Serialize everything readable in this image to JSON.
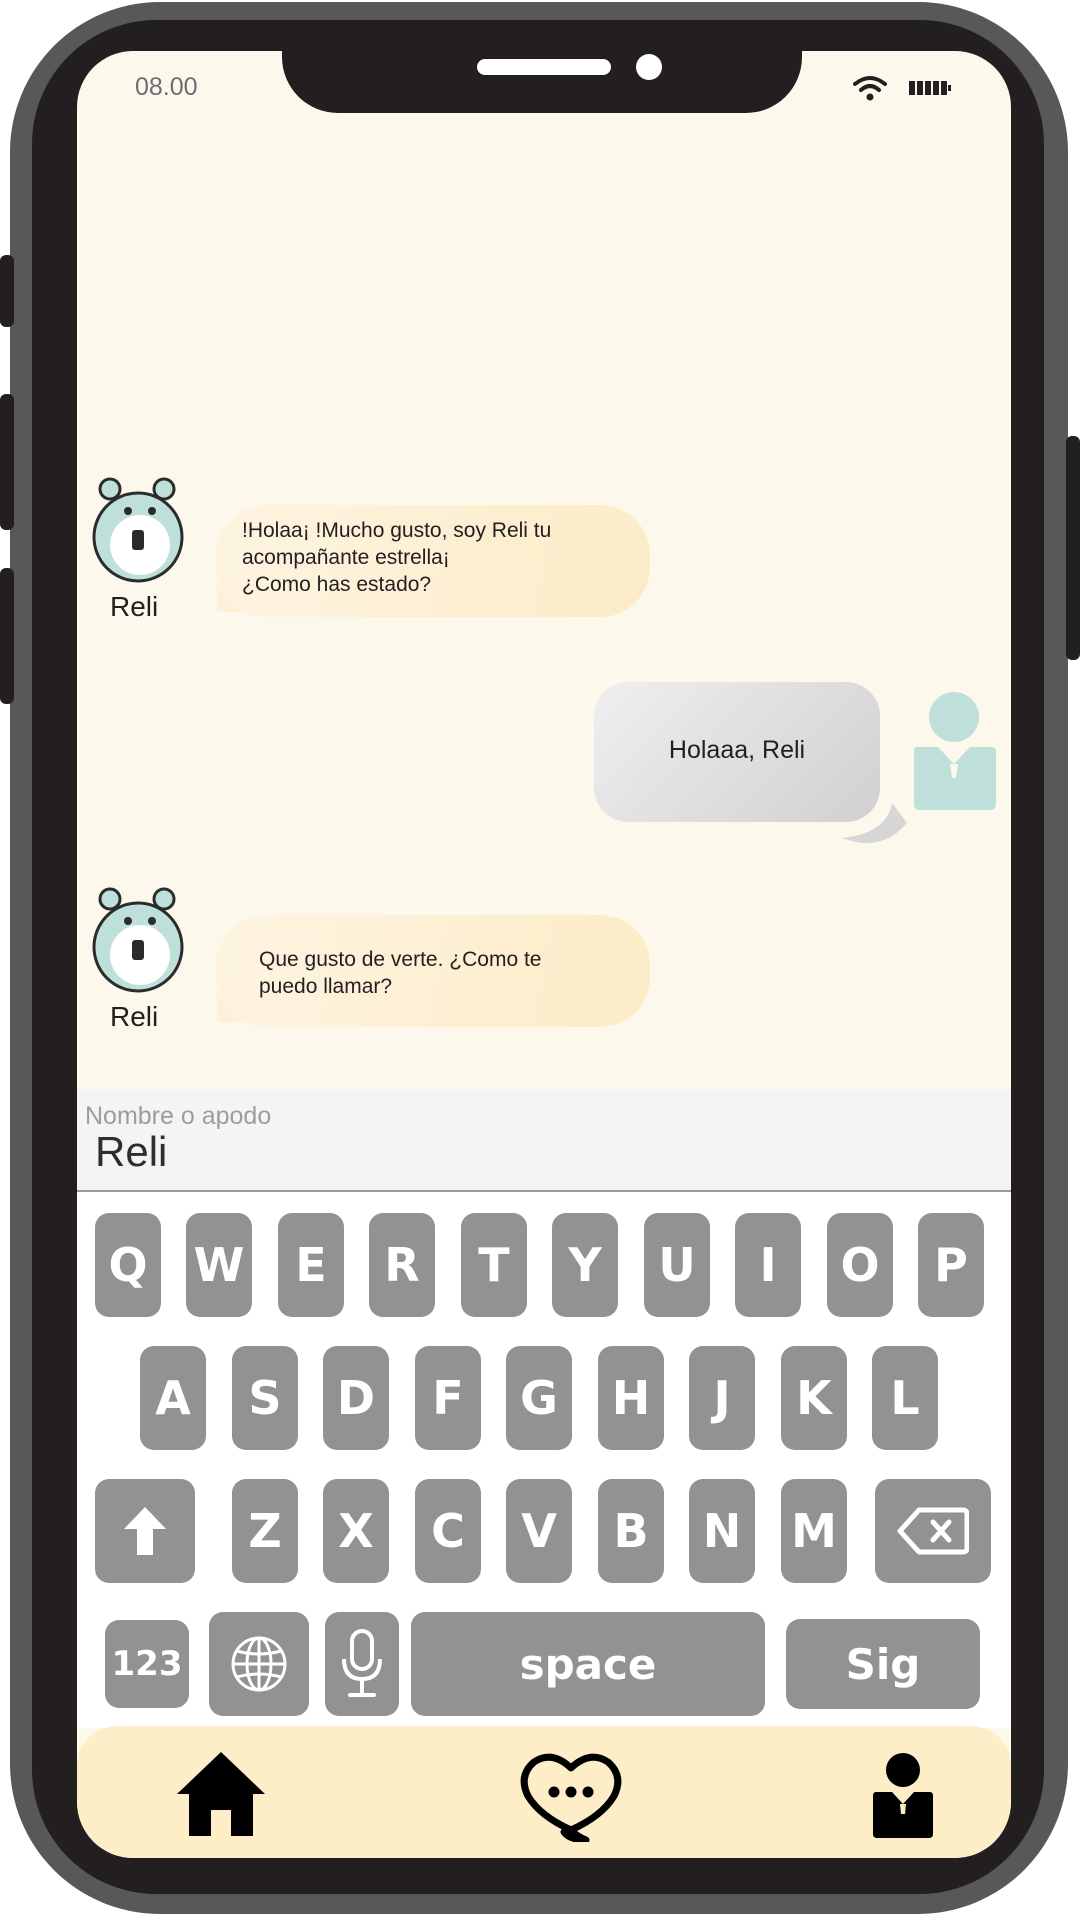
{
  "status_bar": {
    "time": "08.00",
    "wifi_icon": "wifi-icon",
    "battery_icon": "battery-icon"
  },
  "chat": {
    "messages": [
      {
        "sender": "Reli",
        "lines": [
          "!Holaa¡ !Mucho gusto, soy Reli tu",
          "acompañante estrella¡",
          "¿Como has estado?"
        ]
      },
      {
        "sender": "user",
        "text": "Holaaa, Reli"
      },
      {
        "sender": "Reli",
        "lines": [
          "Que gusto de verte. ¿Como te",
          "puedo llamar?"
        ]
      }
    ]
  },
  "input": {
    "placeholder": "Nombre o apodo",
    "value": "Reli"
  },
  "keyboard": {
    "row1": [
      "Q",
      "W",
      "E",
      "R",
      "T",
      "Y",
      "U",
      "I",
      "O",
      "P"
    ],
    "row2": [
      "A",
      "S",
      "D",
      "F",
      "G",
      "H",
      "J",
      "K",
      "L"
    ],
    "row3": [
      "Z",
      "X",
      "C",
      "V",
      "B",
      "N",
      "M"
    ],
    "numbers_label": "123",
    "space_label": "space",
    "next_label": "Sig"
  },
  "colors": {
    "screen_bg": "#fdf8ec",
    "key_bg": "#929292",
    "reli_bubble": "#fdebc7",
    "user_bubble": "#d9d9d9",
    "accent_teal": "#bfe0da",
    "navbar_bg": "#fdeec8"
  },
  "navbar": {
    "icons": [
      "home-icon",
      "chat-heart-icon",
      "profile-icon"
    ]
  }
}
